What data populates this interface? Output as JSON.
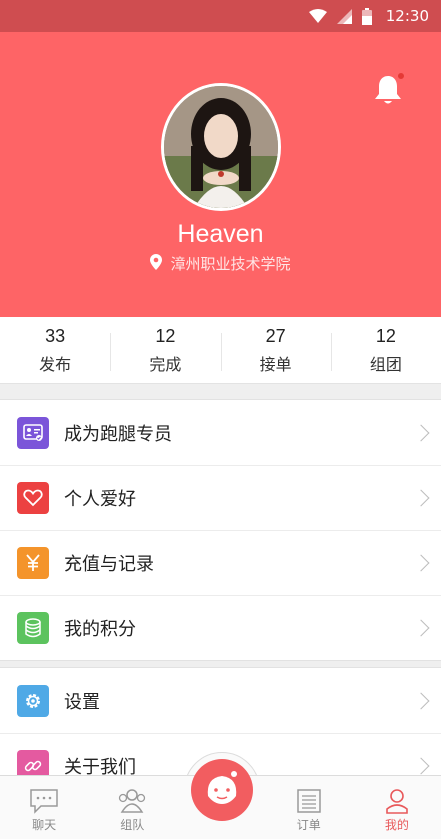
{
  "status_bar": {
    "time": "12:30"
  },
  "profile": {
    "name": "Heaven",
    "school": "漳州职业技术学院",
    "avatar_alt": "avatar"
  },
  "stats": [
    {
      "value": "33",
      "label": "发布"
    },
    {
      "value": "12",
      "label": "完成"
    },
    {
      "value": "27",
      "label": "接单"
    },
    {
      "value": "12",
      "label": "组团"
    }
  ],
  "menu_group_1": [
    {
      "label": "成为跑腿专员",
      "icon": "id-card-icon",
      "color": "#7b55d9"
    },
    {
      "label": "个人爱好",
      "icon": "heart-icon",
      "color": "#ec4141"
    },
    {
      "label": "充值与记录",
      "icon": "yuan-icon",
      "color": "#f4942b"
    },
    {
      "label": "我的积分",
      "icon": "database-icon",
      "color": "#5cc35e"
    }
  ],
  "menu_group_2": [
    {
      "label": "设置",
      "icon": "gear-icon",
      "color": "#4fa9e6"
    },
    {
      "label": "关于我们",
      "icon": "link-icon",
      "color": "#e45aa0"
    }
  ],
  "tabbar": [
    {
      "label": "聊天",
      "icon": "chat-icon"
    },
    {
      "label": "组队",
      "icon": "team-icon"
    },
    {
      "label": "",
      "icon": "center-mascot-icon"
    },
    {
      "label": "订单",
      "icon": "order-list-icon"
    },
    {
      "label": "我的",
      "icon": "person-icon",
      "active": true
    }
  ],
  "colors": {
    "primary": "#fe6466",
    "status_bar": "#cf4d50",
    "active_tab": "#e8595b"
  }
}
